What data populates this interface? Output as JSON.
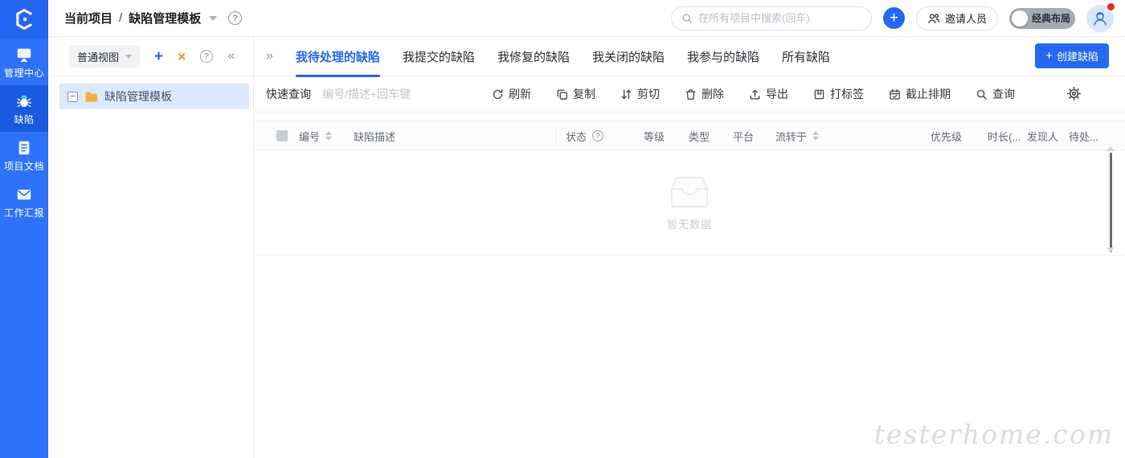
{
  "colors": {
    "accent": "#2468f2",
    "sidebar_blue": "#2e73f7",
    "sidebar_active_blue": "#1a5ae0",
    "orange": "#f6881f",
    "folder_yellow": "#f3b23c",
    "selected_row_bg": "#dbeafe",
    "notification_red": "#f5222d"
  },
  "sidebar": {
    "logo_icon": "hexagon-c-logo",
    "items": [
      {
        "label": "管理中心",
        "icon": "monitor-icon",
        "active": false
      },
      {
        "label": "缺陷",
        "icon": "bug-icon",
        "active": true
      },
      {
        "label": "项目文档",
        "icon": "document-icon",
        "active": false
      },
      {
        "label": "工作汇报",
        "icon": "mail-icon",
        "active": false
      }
    ]
  },
  "header": {
    "breadcrumb": {
      "root": "当前项目",
      "separator": "/",
      "current": "缺陷管理模板"
    },
    "help_icon": "?",
    "search": {
      "placeholder": "在所有项目中搜索(回车)"
    },
    "add_button": "+",
    "invite_button": {
      "label": "邀请人员"
    },
    "layout_toggle": {
      "label": "经典布局",
      "on": false
    },
    "avatar": {
      "has_notification": true
    }
  },
  "explorer": {
    "view_select": {
      "value": "普通视图"
    },
    "add_view_button": "+",
    "close_button": "×",
    "help_button": "?",
    "collapse_button": "«",
    "tree": {
      "selected_node": {
        "expander": "−",
        "label": "缺陷管理模板"
      }
    }
  },
  "tabs": {
    "expand_button": "»",
    "items": [
      {
        "label": "我待处理的缺陷",
        "active": true
      },
      {
        "label": "我提交的缺陷",
        "active": false
      },
      {
        "label": "我修复的缺陷",
        "active": false
      },
      {
        "label": "我关闭的缺陷",
        "active": false
      },
      {
        "label": "我参与的缺陷",
        "active": false
      },
      {
        "label": "所有缺陷",
        "active": false
      }
    ],
    "create_button": {
      "icon": "+",
      "label": "创建缺陷"
    }
  },
  "toolbar": {
    "quick_query_label": "快速查询",
    "query_input": {
      "placeholder": "编号/描述+回车键"
    },
    "actions": [
      {
        "label": "刷新",
        "icon": "refresh-icon"
      },
      {
        "label": "复制",
        "icon": "copy-icon"
      },
      {
        "label": "剪切",
        "icon": "cut-icon"
      },
      {
        "label": "删除",
        "icon": "delete-icon"
      },
      {
        "label": "导出",
        "icon": "export-icon"
      },
      {
        "label": "打标签",
        "icon": "tag-icon"
      },
      {
        "label": "截止排期",
        "icon": "calendar-icon"
      },
      {
        "label": "查询",
        "icon": "search-icon"
      }
    ],
    "settings_icon": "gear-icon"
  },
  "table": {
    "columns": [
      {
        "label": "编号",
        "sortable": true
      },
      {
        "label": "缺陷描述"
      },
      {
        "label": "状态",
        "help": true
      },
      {
        "label": "等级"
      },
      {
        "label": "类型"
      },
      {
        "label": "平台"
      },
      {
        "label": "流转于",
        "sortable": true
      },
      {
        "label": "优先级"
      },
      {
        "label": "时长(..."
      },
      {
        "label": "发现人"
      },
      {
        "label": "待处..."
      }
    ]
  },
  "empty_state": {
    "label": "暂无数据",
    "icon": "empty-inbox-icon"
  },
  "watermark": "testerhome.com"
}
